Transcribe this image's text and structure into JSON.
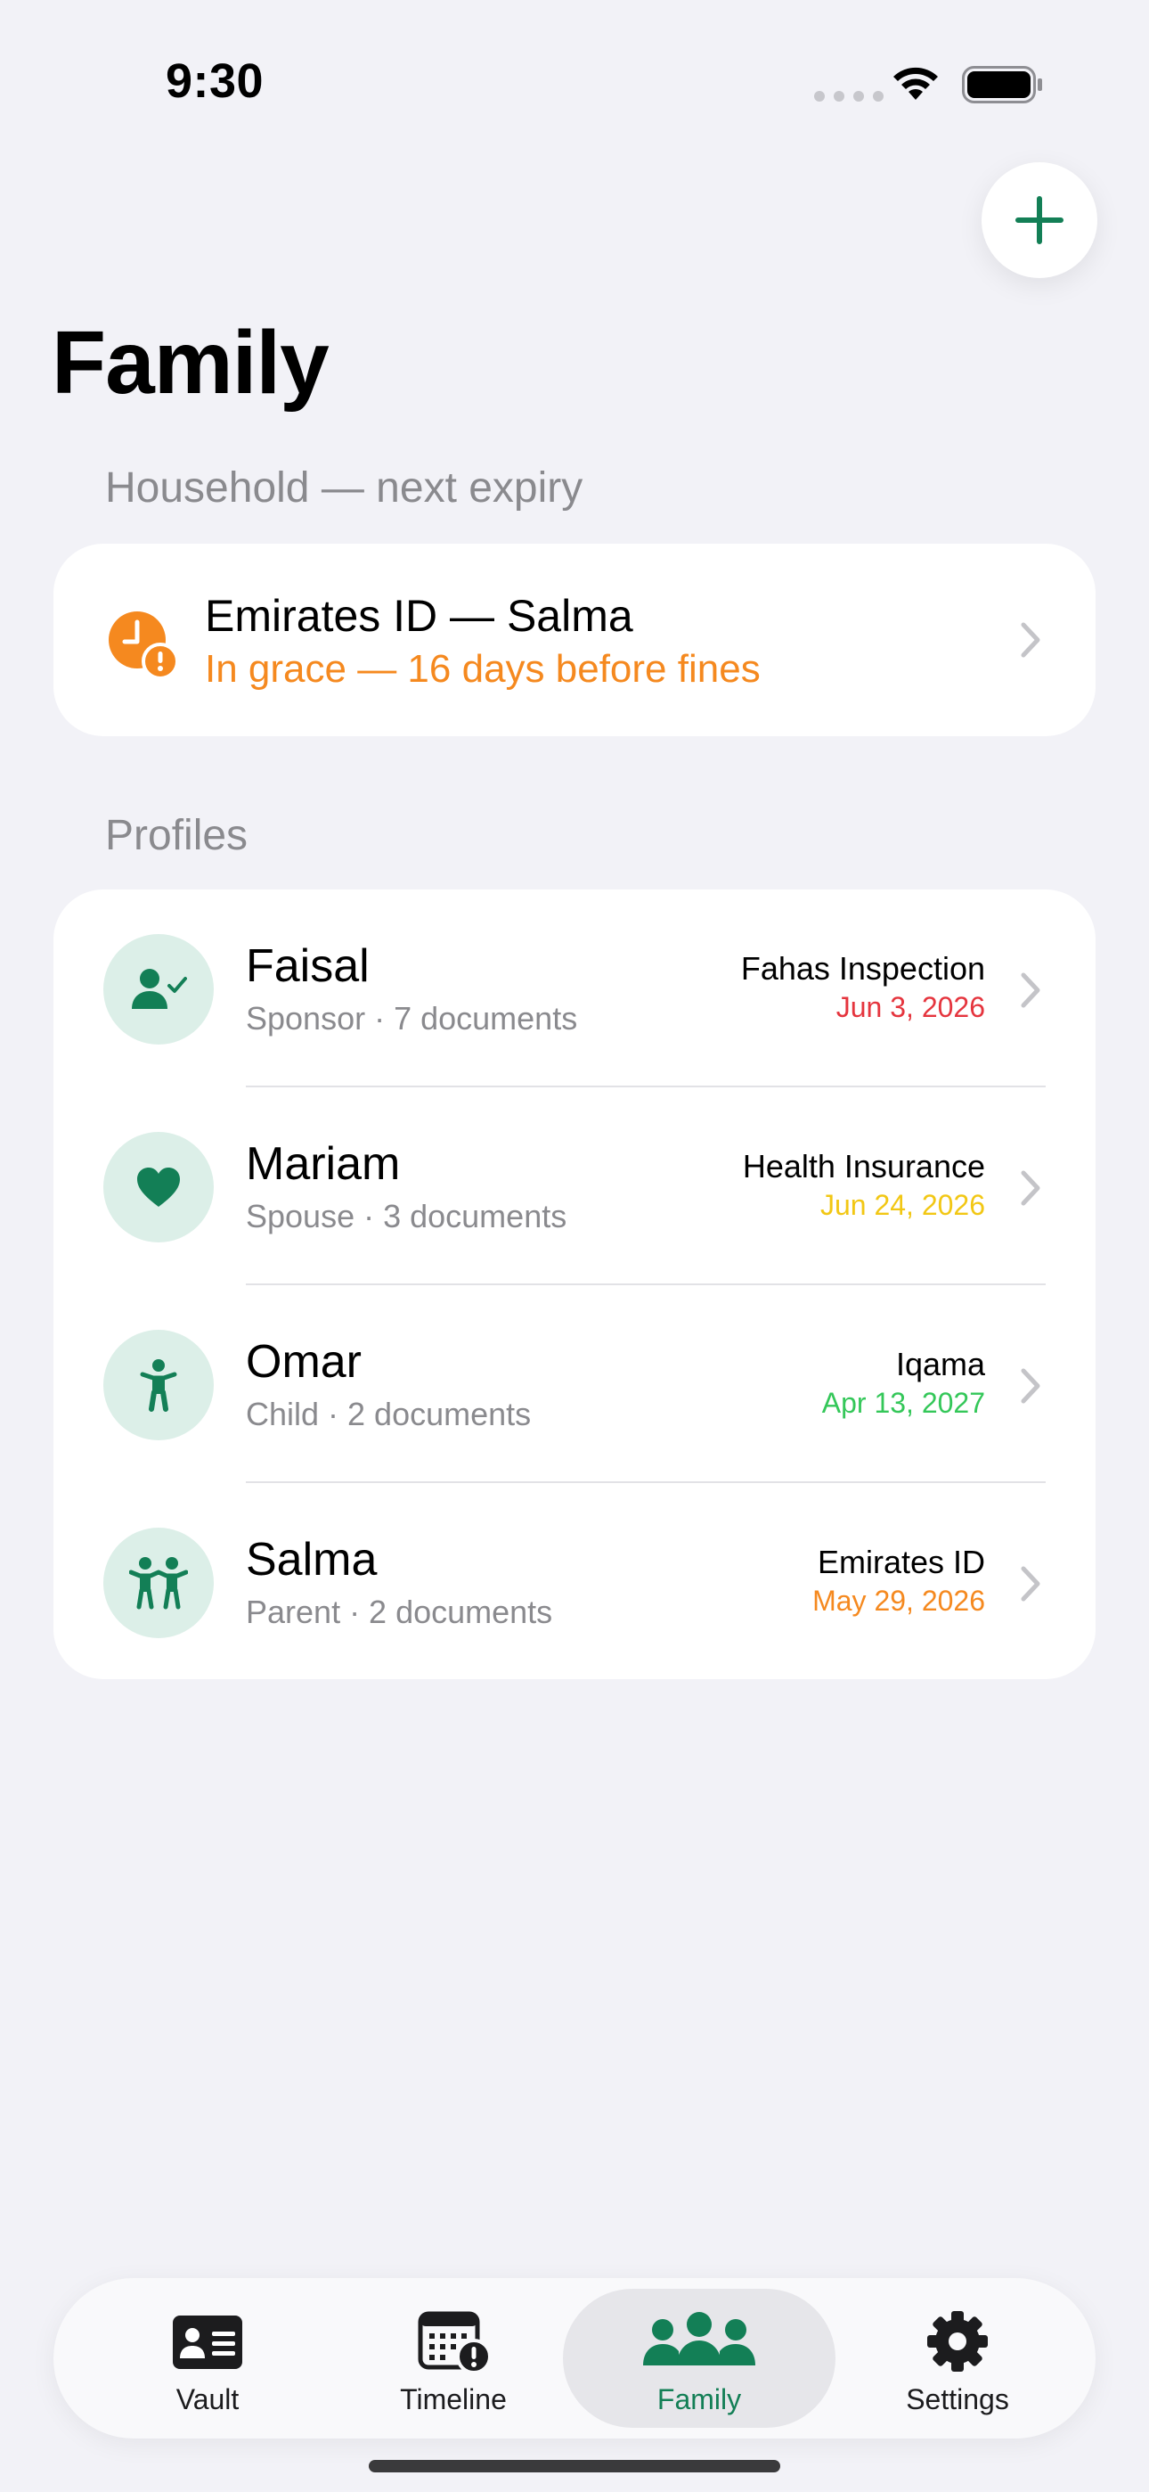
{
  "status_bar": {
    "time": "9:30"
  },
  "header": {
    "title": "Family"
  },
  "household": {
    "section_title": "Household — next expiry",
    "title": "Emirates ID — Salma",
    "subtitle": "In grace — 16 days before fines",
    "subtitle_color": "#F5891F"
  },
  "profiles": {
    "section_title": "Profiles",
    "items": [
      {
        "name": "Faisal",
        "meta": "Sponsor · 7 documents",
        "doc": "Fahas Inspection",
        "date": "Jun 3, 2026",
        "date_color": "#E5353E",
        "icon": "person-check-icon"
      },
      {
        "name": "Mariam",
        "meta": "Spouse · 3 documents",
        "doc": "Health Insurance",
        "date": "Jun 24, 2026",
        "date_color": "#F2C714",
        "icon": "heart-icon"
      },
      {
        "name": "Omar",
        "meta": "Child · 2 documents",
        "doc": "Iqama",
        "date": "Apr 13, 2027",
        "date_color": "#34C759",
        "icon": "child-icon"
      },
      {
        "name": "Salma",
        "meta": "Parent · 2 documents",
        "doc": "Emirates ID",
        "date": "May 29, 2026",
        "date_color": "#F5891F",
        "icon": "two-people-icon"
      }
    ]
  },
  "tabs": [
    {
      "label": "Vault",
      "icon": "id-card-icon"
    },
    {
      "label": "Timeline",
      "icon": "calendar-alert-icon"
    },
    {
      "label": "Family",
      "icon": "family-icon",
      "selected": true
    },
    {
      "label": "Settings",
      "icon": "gear-icon"
    }
  ],
  "colors": {
    "accent": "#137F56",
    "avatar_bg": "#DCEFE8",
    "background": "#F2F2F7"
  }
}
